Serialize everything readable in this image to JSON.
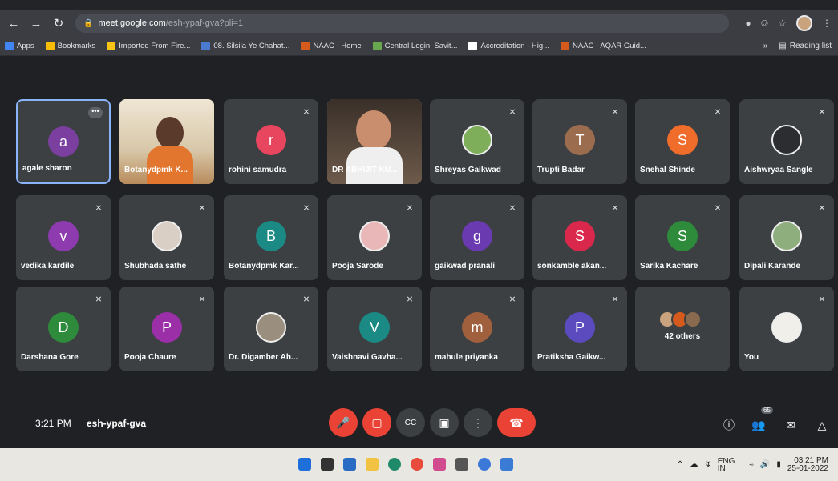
{
  "browser": {
    "url_host": "meet.google.com",
    "url_path": "/esh-ypaf-gva?pli=1"
  },
  "bookmarks": [
    {
      "label": "Apps",
      "color": "#4285f4"
    },
    {
      "label": "Bookmarks",
      "color": "#fbbc04"
    },
    {
      "label": "Imported From Fire...",
      "color": "#f9c514"
    },
    {
      "label": "08. Silsila Ye Chahat...",
      "color": "#4a7bd1"
    },
    {
      "label": "NAAC - Home",
      "color": "#d65a1c"
    },
    {
      "label": "Central Login: Savit...",
      "color": "#6aa84f"
    },
    {
      "label": "Accreditation - Hig...",
      "color": "#ffffff"
    },
    {
      "label": "NAAC - AQAR Guid...",
      "color": "#d65a1c"
    }
  ],
  "reading_list": "Reading list",
  "tiles": [
    {
      "name": "agale sharon",
      "letter": "a",
      "color": "#7b3fa0",
      "kind": "letter",
      "selected": true
    },
    {
      "name": "Botanydpmk K...",
      "kind": "video"
    },
    {
      "name": "rohini samudra",
      "letter": "r",
      "color": "#e8455e",
      "kind": "letter"
    },
    {
      "name": "DR ABHIJIT KU...",
      "kind": "video"
    },
    {
      "name": "Shreyas Gaikwad",
      "kind": "photo",
      "color": "#7fae5a"
    },
    {
      "name": "Trupti Badar",
      "letter": "T",
      "color": "#9c6c4e",
      "kind": "letter"
    },
    {
      "name": "Snehal Shinde",
      "letter": "S",
      "color": "#ef6c2b",
      "kind": "letter"
    },
    {
      "name": "Aishwryaa Sangle",
      "kind": "photo",
      "color": "#2b2d30"
    },
    {
      "name": "vedika kardile",
      "letter": "v",
      "color": "#8e3bb0",
      "kind": "letter"
    },
    {
      "name": "Shubhada sathe",
      "kind": "photo",
      "color": "#d9cfc4"
    },
    {
      "name": "Botanydpmk Kar...",
      "letter": "B",
      "color": "#1b8a84",
      "kind": "letter"
    },
    {
      "name": "Pooja Sarode",
      "kind": "photo",
      "color": "#e9b7b8"
    },
    {
      "name": "gaikwad pranali",
      "letter": "g",
      "color": "#6a3bb0",
      "kind": "letter"
    },
    {
      "name": "sonkamble akan...",
      "letter": "S",
      "color": "#d9284c",
      "kind": "letter"
    },
    {
      "name": "Sarika Kachare",
      "letter": "S",
      "color": "#2e8b3c",
      "kind": "letter"
    },
    {
      "name": "Dipali Karande",
      "kind": "photo",
      "color": "#8fae7d"
    },
    {
      "name": "Darshana Gore",
      "letter": "D",
      "color": "#2e8b3c",
      "kind": "letter"
    },
    {
      "name": "Pooja Chaure",
      "letter": "P",
      "color": "#9b2fa8",
      "kind": "letter"
    },
    {
      "name": "Dr. Digamber Ah...",
      "kind": "photo",
      "color": "#9a8f7f"
    },
    {
      "name": "Vaishnavi Gavha...",
      "letter": "V",
      "color": "#1b8a84",
      "kind": "letter"
    },
    {
      "name": "mahule priyanka",
      "letter": "m",
      "color": "#a0603e",
      "kind": "letter"
    },
    {
      "name": "Pratiksha Gaikw...",
      "letter": "P",
      "color": "#5c4bbf",
      "kind": "letter"
    },
    {
      "name": "42 others",
      "kind": "others"
    },
    {
      "name": "You",
      "kind": "photo",
      "color": "#f1efe9"
    }
  ],
  "meeting": {
    "time": "3:21 PM",
    "code": "esh-ypaf-gva",
    "people_count": "65"
  },
  "taskbar": {
    "lang_top": "ENG",
    "lang_bottom": "IN",
    "clock_time": "03:21 PM",
    "clock_date": "25-01-2022"
  }
}
